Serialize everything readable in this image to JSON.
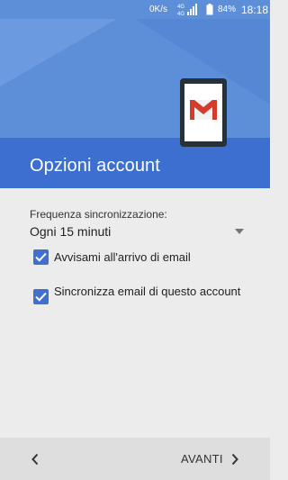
{
  "status_bar": {
    "net_speed": "0K/s",
    "network_label": "4G",
    "battery_percent": "84%",
    "time": "18:18"
  },
  "header": {
    "title": "Opzioni account",
    "illustration": "phone-gmail-icon"
  },
  "sync": {
    "frequency_label": "Frequenza sincronizzazione:",
    "frequency_value": "Ogni 15 minuti"
  },
  "options": [
    {
      "label": "Avvisami all'arrivo di email",
      "checked": true
    },
    {
      "label": "Sincronizza email di questo account",
      "checked": true
    }
  ],
  "footer": {
    "back_icon": "chevron-left-icon",
    "next_label": "AVANTI"
  },
  "colors": {
    "status_bar": "#5d8fd8",
    "header_dark": "#3d6fd0",
    "accent": "#3f6fcf",
    "gmail_red": "#d33b2c"
  }
}
